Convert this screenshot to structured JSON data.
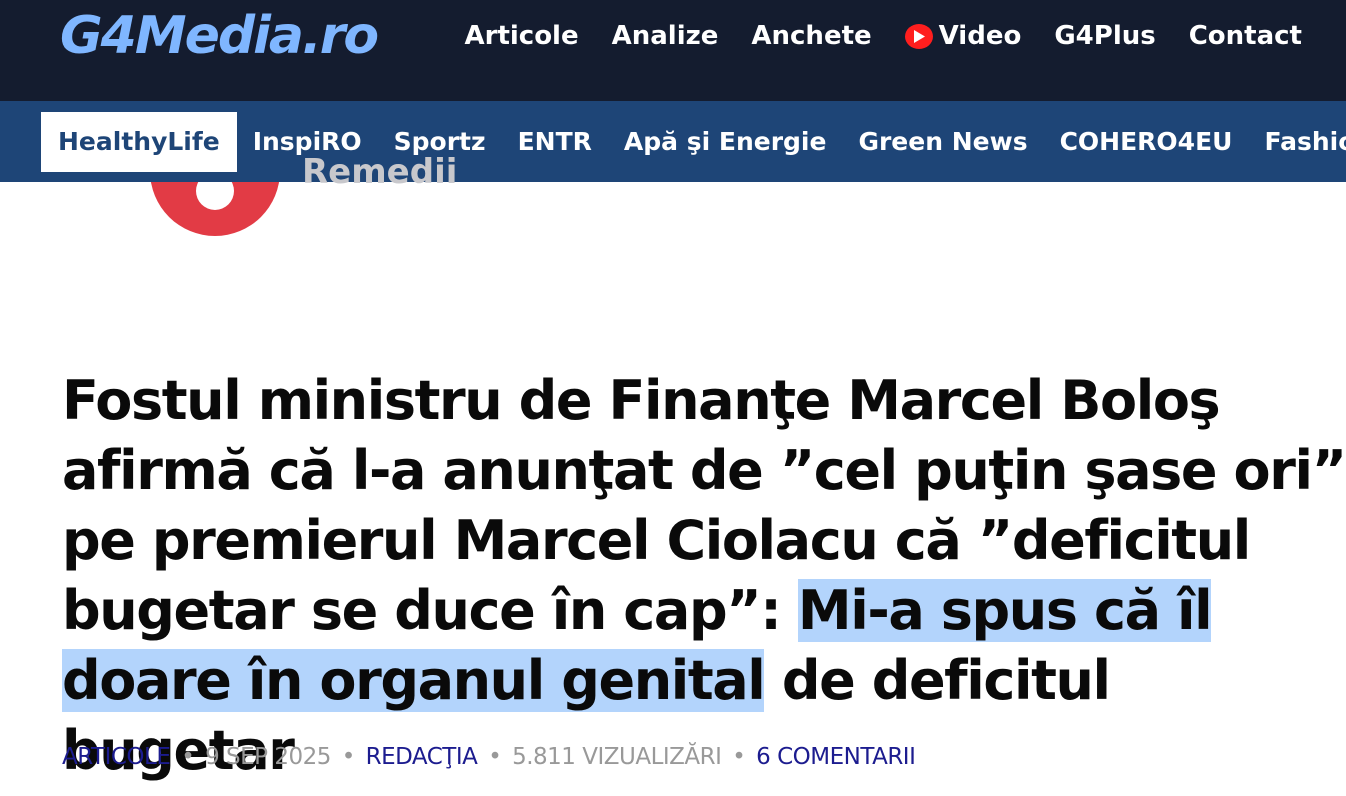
{
  "site": {
    "logo": "G4Media.ro"
  },
  "main_nav": [
    {
      "label": "Articole"
    },
    {
      "label": "Analize"
    },
    {
      "label": "Anchete"
    },
    {
      "label": "Video",
      "icon": "youtube-play-icon"
    },
    {
      "label": "G4Plus"
    },
    {
      "label": "Contact"
    }
  ],
  "sub_nav": [
    {
      "label": "HealthyLife",
      "active": true
    },
    {
      "label": "InspiRO"
    },
    {
      "label": "Sportz"
    },
    {
      "label": "ENTR"
    },
    {
      "label": "Apă şi Energie"
    },
    {
      "label": "Green News"
    },
    {
      "label": "COHERO4EU"
    },
    {
      "label": "Fashion"
    }
  ],
  "partner": {
    "text": "Remedii"
  },
  "article": {
    "headline_plain": "Fostul ministru de Finanţe Marcel Boloş afirmă că l-a anunţat de ”cel puţin şase ori” pe premierul Marcel Ciolacu că ”deficitul bugetar se duce în cap”: ",
    "headline_highlight": "Mi-a spus că îl doare în organul genital",
    "headline_tail": " de deficitul bugetar",
    "meta": {
      "category": "ARTICOLE",
      "date": "9 SEP 2025",
      "author": "REDACŢIA",
      "views": "5.811 VIZUALIZĂRI",
      "comments": "6 COMENTARII",
      "separator": "•"
    }
  },
  "colors": {
    "topbar": "#141c2f",
    "subnav": "#1e4577",
    "logo": "#7fb6ff",
    "highlight": "#b3d4fc",
    "meta_link": "#1c1c8f",
    "youtube_red": "#ff1e1e"
  }
}
